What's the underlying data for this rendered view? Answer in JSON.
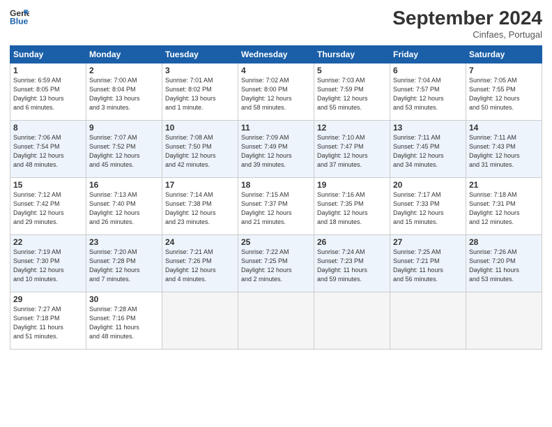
{
  "logo": {
    "line1": "General",
    "line2": "Blue"
  },
  "title": "September 2024",
  "subtitle": "Cinfaes, Portugal",
  "headers": [
    "Sunday",
    "Monday",
    "Tuesday",
    "Wednesday",
    "Thursday",
    "Friday",
    "Saturday"
  ],
  "weeks": [
    [
      {
        "day": "1",
        "info": "Sunrise: 6:59 AM\nSunset: 8:05 PM\nDaylight: 13 hours\nand 6 minutes."
      },
      {
        "day": "2",
        "info": "Sunrise: 7:00 AM\nSunset: 8:04 PM\nDaylight: 13 hours\nand 3 minutes."
      },
      {
        "day": "3",
        "info": "Sunrise: 7:01 AM\nSunset: 8:02 PM\nDaylight: 13 hours\nand 1 minute."
      },
      {
        "day": "4",
        "info": "Sunrise: 7:02 AM\nSunset: 8:00 PM\nDaylight: 12 hours\nand 58 minutes."
      },
      {
        "day": "5",
        "info": "Sunrise: 7:03 AM\nSunset: 7:59 PM\nDaylight: 12 hours\nand 55 minutes."
      },
      {
        "day": "6",
        "info": "Sunrise: 7:04 AM\nSunset: 7:57 PM\nDaylight: 12 hours\nand 53 minutes."
      },
      {
        "day": "7",
        "info": "Sunrise: 7:05 AM\nSunset: 7:55 PM\nDaylight: 12 hours\nand 50 minutes."
      }
    ],
    [
      {
        "day": "8",
        "info": "Sunrise: 7:06 AM\nSunset: 7:54 PM\nDaylight: 12 hours\nand 48 minutes."
      },
      {
        "day": "9",
        "info": "Sunrise: 7:07 AM\nSunset: 7:52 PM\nDaylight: 12 hours\nand 45 minutes."
      },
      {
        "day": "10",
        "info": "Sunrise: 7:08 AM\nSunset: 7:50 PM\nDaylight: 12 hours\nand 42 minutes."
      },
      {
        "day": "11",
        "info": "Sunrise: 7:09 AM\nSunset: 7:49 PM\nDaylight: 12 hours\nand 39 minutes."
      },
      {
        "day": "12",
        "info": "Sunrise: 7:10 AM\nSunset: 7:47 PM\nDaylight: 12 hours\nand 37 minutes."
      },
      {
        "day": "13",
        "info": "Sunrise: 7:11 AM\nSunset: 7:45 PM\nDaylight: 12 hours\nand 34 minutes."
      },
      {
        "day": "14",
        "info": "Sunrise: 7:11 AM\nSunset: 7:43 PM\nDaylight: 12 hours\nand 31 minutes."
      }
    ],
    [
      {
        "day": "15",
        "info": "Sunrise: 7:12 AM\nSunset: 7:42 PM\nDaylight: 12 hours\nand 29 minutes."
      },
      {
        "day": "16",
        "info": "Sunrise: 7:13 AM\nSunset: 7:40 PM\nDaylight: 12 hours\nand 26 minutes."
      },
      {
        "day": "17",
        "info": "Sunrise: 7:14 AM\nSunset: 7:38 PM\nDaylight: 12 hours\nand 23 minutes."
      },
      {
        "day": "18",
        "info": "Sunrise: 7:15 AM\nSunset: 7:37 PM\nDaylight: 12 hours\nand 21 minutes."
      },
      {
        "day": "19",
        "info": "Sunrise: 7:16 AM\nSunset: 7:35 PM\nDaylight: 12 hours\nand 18 minutes."
      },
      {
        "day": "20",
        "info": "Sunrise: 7:17 AM\nSunset: 7:33 PM\nDaylight: 12 hours\nand 15 minutes."
      },
      {
        "day": "21",
        "info": "Sunrise: 7:18 AM\nSunset: 7:31 PM\nDaylight: 12 hours\nand 12 minutes."
      }
    ],
    [
      {
        "day": "22",
        "info": "Sunrise: 7:19 AM\nSunset: 7:30 PM\nDaylight: 12 hours\nand 10 minutes."
      },
      {
        "day": "23",
        "info": "Sunrise: 7:20 AM\nSunset: 7:28 PM\nDaylight: 12 hours\nand 7 minutes."
      },
      {
        "day": "24",
        "info": "Sunrise: 7:21 AM\nSunset: 7:26 PM\nDaylight: 12 hours\nand 4 minutes."
      },
      {
        "day": "25",
        "info": "Sunrise: 7:22 AM\nSunset: 7:25 PM\nDaylight: 12 hours\nand 2 minutes."
      },
      {
        "day": "26",
        "info": "Sunrise: 7:24 AM\nSunset: 7:23 PM\nDaylight: 11 hours\nand 59 minutes."
      },
      {
        "day": "27",
        "info": "Sunrise: 7:25 AM\nSunset: 7:21 PM\nDaylight: 11 hours\nand 56 minutes."
      },
      {
        "day": "28",
        "info": "Sunrise: 7:26 AM\nSunset: 7:20 PM\nDaylight: 11 hours\nand 53 minutes."
      }
    ],
    [
      {
        "day": "29",
        "info": "Sunrise: 7:27 AM\nSunset: 7:18 PM\nDaylight: 11 hours\nand 51 minutes."
      },
      {
        "day": "30",
        "info": "Sunrise: 7:28 AM\nSunset: 7:16 PM\nDaylight: 11 hours\nand 48 minutes."
      },
      {
        "day": "",
        "info": ""
      },
      {
        "day": "",
        "info": ""
      },
      {
        "day": "",
        "info": ""
      },
      {
        "day": "",
        "info": ""
      },
      {
        "day": "",
        "info": ""
      }
    ]
  ]
}
